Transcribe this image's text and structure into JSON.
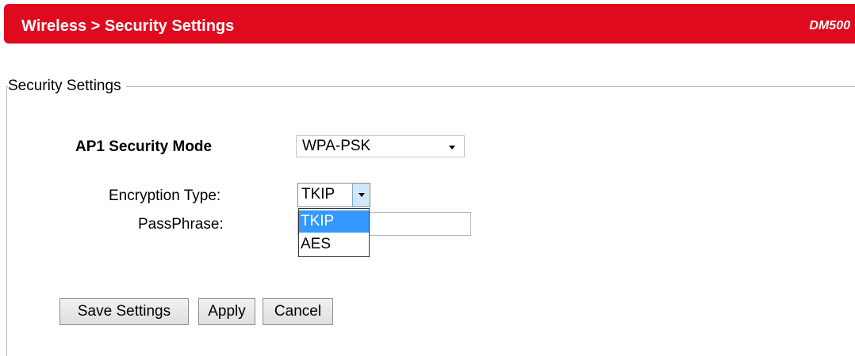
{
  "header": {
    "breadcrumb": "Wireless > Security Settings",
    "model": "DM500",
    "color": "#e00a1e"
  },
  "section": {
    "legend": "Security Settings"
  },
  "form": {
    "mode_label": "AP1 Security Mode",
    "mode_value": "WPA-PSK",
    "encryption_label": "Encryption Type:",
    "encryption_value": "TKIP",
    "encryption_options": [
      "TKIP",
      "AES"
    ],
    "passphrase_label": "PassPhrase:",
    "passphrase_value": ""
  },
  "buttons": {
    "save": "Save Settings",
    "apply": "Apply",
    "cancel": "Cancel"
  }
}
